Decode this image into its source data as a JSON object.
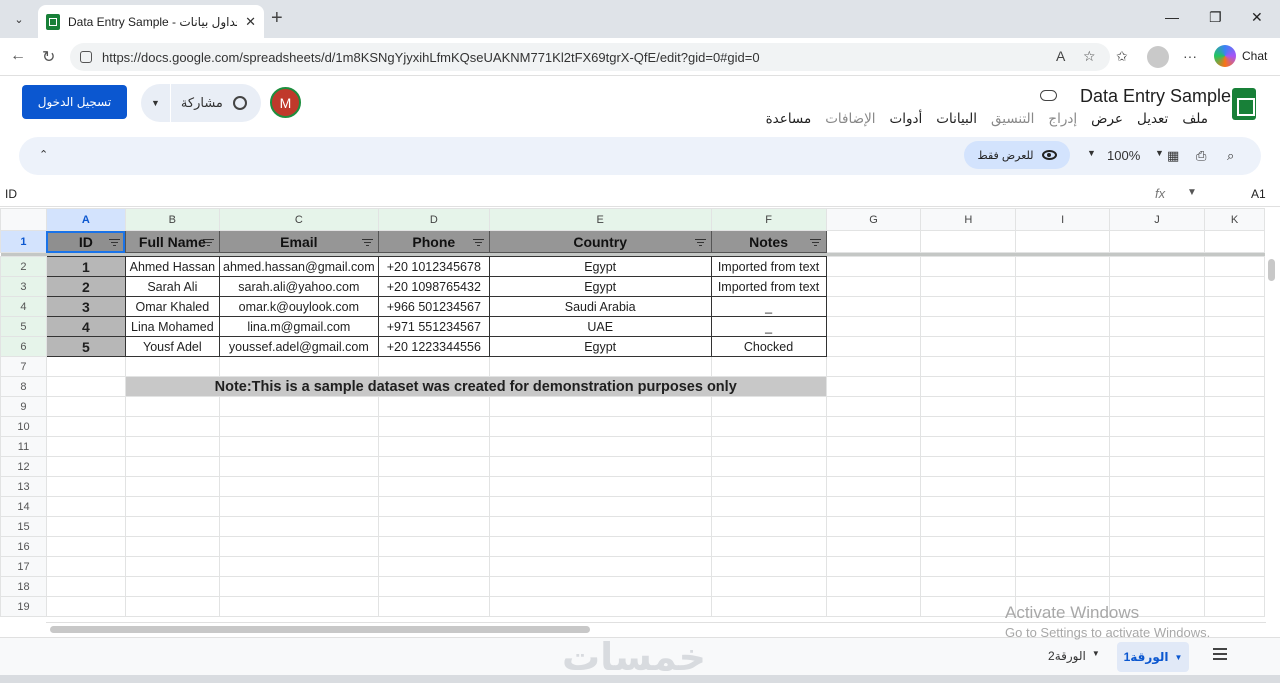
{
  "browser": {
    "tab_title": "Data Entry Sample - جداول بيانات G",
    "url": "https://docs.google.com/spreadsheets/d/1m8KSNgYjyxihLfmKQseUAKNM771Kl2tFX69tgrX-QfE/edit?gid=0#gid=0",
    "chat_label": "Chat"
  },
  "header": {
    "doc_title": "Data Entry Sample",
    "signin_label": "تسجيل الدخول",
    "share_label": "مشاركة",
    "avatar_letter": "M",
    "menu": [
      {
        "label": "ملف",
        "dim": false
      },
      {
        "label": "تعديل",
        "dim": false
      },
      {
        "label": "عرض",
        "dim": false
      },
      {
        "label": "إدراج",
        "dim": true
      },
      {
        "label": "التنسيق",
        "dim": true
      },
      {
        "label": "البيانات",
        "dim": false
      },
      {
        "label": "أدوات",
        "dim": false
      },
      {
        "label": "الإضافات",
        "dim": true
      },
      {
        "label": "مساعدة",
        "dim": false
      }
    ]
  },
  "toolbar": {
    "zoom": "100%",
    "view_only_label": "للعرض فقط"
  },
  "formula_bar": {
    "cell_ref": "A1",
    "value": "ID"
  },
  "sheet": {
    "columns": [
      "A",
      "B",
      "C",
      "D",
      "E",
      "F",
      "G",
      "H",
      "I",
      "J",
      "K"
    ],
    "headers": [
      "ID",
      "Full Name",
      "Email",
      "Phone",
      "Country",
      "Notes"
    ],
    "rows": [
      [
        "1",
        "Ahmed Hassan",
        "ahmed.hassan@gmail.com",
        "+20 1012345678",
        "Egypt",
        "Imported from text"
      ],
      [
        "2",
        "Sarah Ali",
        "sarah.ali@yahoo.com",
        "+20 1098765432",
        "Egypt",
        "Imported from text"
      ],
      [
        "3",
        "Omar Khaled",
        "omar.k@ouylook.com",
        "+966 501234567",
        "Saudi Arabia",
        "_"
      ],
      [
        "4",
        "Lina Mohamed",
        "lina.m@gmail.com",
        "+971 551234567",
        "UAE",
        "_"
      ],
      [
        "5",
        "Yousf Adel",
        "youssef.adel@gmail.com",
        "+20 1223344556",
        "Egypt",
        "Chocked"
      ]
    ],
    "note": "Note:This is a sample dataset was created for demonstration purposes only",
    "row_numbers": [
      "1",
      "2",
      "3",
      "4",
      "5",
      "6",
      "7",
      "8",
      "9",
      "10",
      "11",
      "12",
      "13",
      "14",
      "15",
      "16",
      "17",
      "18",
      "19"
    ]
  },
  "sheet_tabs": {
    "active": "الورقة1",
    "other": "الورقة2"
  },
  "overlay": {
    "activate_title": "Activate Windows",
    "activate_sub": "Go to Settings to activate Windows.",
    "brand": "خمسات"
  }
}
